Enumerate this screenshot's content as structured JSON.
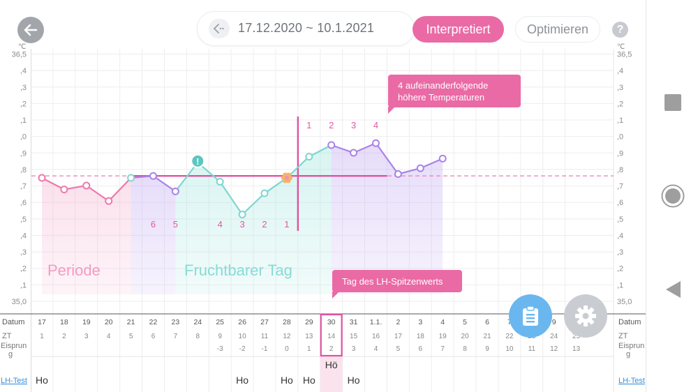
{
  "header": {
    "date_range": "17.12.2020 ~ 10.1.2021",
    "btn_interpreted": "Interpretiert",
    "btn_optimize": "Optimieren",
    "help": "?"
  },
  "colors": {
    "accent_pink": "#ea6aa5",
    "purple": "#a983e8",
    "teal": "#7fd6d0",
    "blue": "#6ab7ef"
  },
  "chart_data": {
    "type": "line",
    "unit_left": "℃",
    "unit_right": "℃",
    "y_tick_labels": [
      "36,5",
      ",4",
      ",3",
      ",2",
      ",1",
      ",0",
      ",9",
      ",8",
      ",7",
      ",6",
      ",5",
      ",4",
      ",3",
      ",2",
      ",1",
      "35,0"
    ],
    "ylim": [
      35.0,
      36.5
    ],
    "coverline": 36.75,
    "x": [
      "17",
      "18",
      "19",
      "20",
      "21",
      "22",
      "23",
      "24",
      "25",
      "26",
      "27",
      "28",
      "29",
      "30",
      "31",
      "1.1.",
      "2",
      "3",
      "4",
      "5",
      "6",
      "7",
      "8",
      "9",
      "10"
    ],
    "temperatures": [
      36.74,
      36.68,
      36.7,
      36.62,
      36.74,
      36.75,
      36.67,
      36.82,
      36.72,
      36.55,
      36.66,
      36.74,
      36.85,
      36.91,
      36.87,
      36.92,
      36.76,
      36.79,
      36.84
    ],
    "special_points": {
      "exclamation_index": 7,
      "ovulation_index": 11
    },
    "series_labels": {
      "period": "Periode",
      "fertile": "Fruchtbarer Tag"
    },
    "countdown_labels": [
      "6",
      "5",
      "4",
      "3",
      "2",
      "1"
    ],
    "countdown_indices": [
      5,
      6,
      8,
      9,
      10,
      11
    ],
    "higher_labels": [
      "1",
      "2",
      "3",
      "4"
    ],
    "higher_indices": [
      12,
      13,
      14,
      15
    ]
  },
  "annotations": {
    "higher_temps": "4 aufeinanderfolgende höhere Temperaturen",
    "lh_peak": "Tag des LH-Spitzenwerts"
  },
  "table": {
    "labels": {
      "datum": "Datum",
      "zt": "ZT",
      "eisprung_1": "Eisprun",
      "eisprung_2": "g",
      "lh_test": "LH-Test"
    },
    "zt": [
      "1",
      "2",
      "3",
      "4",
      "5",
      "6",
      "7",
      "8",
      "9",
      "10",
      "11",
      "12",
      "13",
      "14",
      "15",
      "16",
      "17",
      "18",
      "19",
      "20",
      "21",
      "22",
      "23",
      "24",
      "25"
    ],
    "eisprung": [
      "",
      "",
      "",
      "",
      "",
      "",
      "",
      "",
      "-3",
      "-2",
      "-1",
      "0",
      "1",
      "2",
      "3",
      "4",
      "5",
      "6",
      "7",
      "8",
      "9",
      "10",
      "11",
      "12",
      "13"
    ],
    "lh_marks": {
      "0": "Ho",
      "9": "Ho",
      "11": "Ho",
      "12": "Ho",
      "14": "Ho"
    },
    "selected_index": 13,
    "selected_mark": "Hö"
  }
}
